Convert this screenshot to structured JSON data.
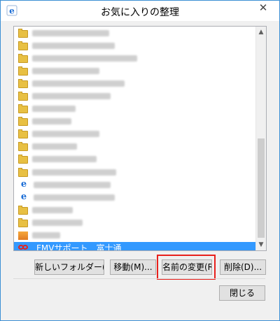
{
  "window": {
    "title": "お気に入りの整理",
    "close_glyph": "✕"
  },
  "list": {
    "items": [
      {
        "icon": "folder"
      },
      {
        "icon": "folder"
      },
      {
        "icon": "folder"
      },
      {
        "icon": "folder"
      },
      {
        "icon": "folder"
      },
      {
        "icon": "folder"
      },
      {
        "icon": "folder"
      },
      {
        "icon": "folder"
      },
      {
        "icon": "folder"
      },
      {
        "icon": "folder"
      },
      {
        "icon": "folder"
      },
      {
        "icon": "folder"
      },
      {
        "icon": "ie"
      },
      {
        "icon": "ie"
      },
      {
        "icon": "folder"
      },
      {
        "icon": "folder"
      },
      {
        "icon": "thumbnail"
      }
    ],
    "selected_item": {
      "label": "FMVサポート　富士通",
      "icon": "fmv-icon"
    }
  },
  "buttons": {
    "new_folder": "新しいフォルダー(N)",
    "move": "移動(M)...",
    "rename": "名前の変更(R)",
    "delete": "削除(D)...",
    "close": "閉じる"
  },
  "colors": {
    "selection": "#3399ff",
    "highlight_frame": "#e8201c",
    "folder": "#e8c043"
  }
}
